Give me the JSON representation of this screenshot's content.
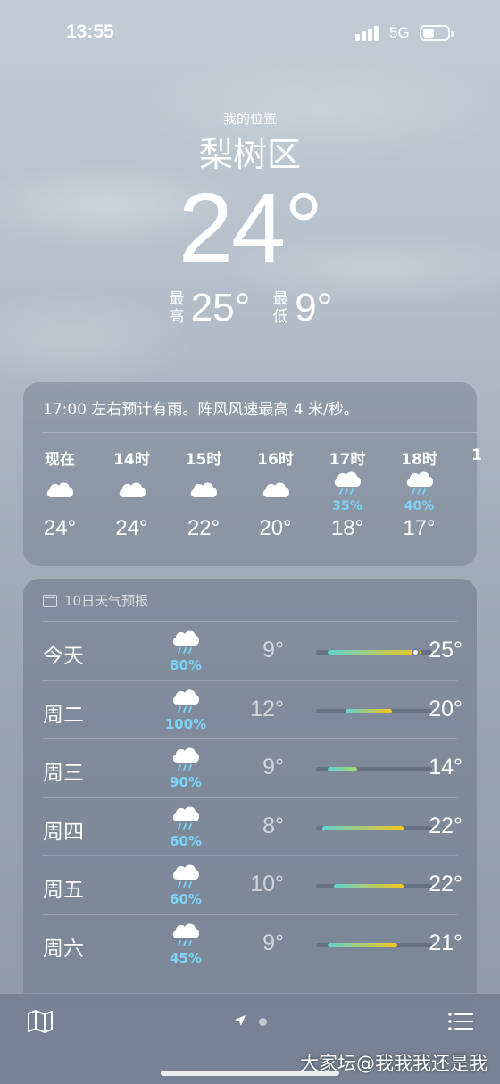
{
  "status_bar": {
    "time": "13:55",
    "network": "5G"
  },
  "header": {
    "my_location": "我的位置",
    "city": "梨树区",
    "temperature": "24°",
    "high_label": "最高",
    "high": "25°",
    "low_label": "最低",
    "low": "9°"
  },
  "hourly": {
    "summary": "17:00 左右预计有雨。阵风风速最高 4 米/秒。",
    "items": [
      {
        "time": "现在",
        "icon": "cloud-icon",
        "precip": "",
        "temp": "24°"
      },
      {
        "time": "14时",
        "icon": "cloud-icon",
        "precip": "",
        "temp": "24°"
      },
      {
        "time": "15时",
        "icon": "cloud-icon",
        "precip": "",
        "temp": "22°"
      },
      {
        "time": "16时",
        "icon": "cloud-icon",
        "precip": "",
        "temp": "20°"
      },
      {
        "time": "17时",
        "icon": "rain-cloud-icon",
        "precip": "35%",
        "temp": "18°"
      },
      {
        "time": "18时",
        "icon": "rain-cloud-icon",
        "precip": "40%",
        "temp": "17°"
      }
    ]
  },
  "daily": {
    "title": "10日天气预报",
    "days": [
      {
        "day": "今天",
        "precip": "80%",
        "low": "9°",
        "high": "25°"
      },
      {
        "day": "周二",
        "precip": "100%",
        "low": "12°",
        "high": "20°"
      },
      {
        "day": "周三",
        "precip": "90%",
        "low": "9°",
        "high": "14°"
      },
      {
        "day": "周四",
        "precip": "60%",
        "low": "8°",
        "high": "22°"
      },
      {
        "day": "周五",
        "precip": "60%",
        "low": "10°",
        "high": "22°"
      },
      {
        "day": "周六",
        "precip": "45%",
        "low": "9°",
        "high": "21°"
      }
    ]
  },
  "bottom_bar": {
    "watermark": "大家坛@我我我还是我"
  },
  "colors": {
    "precip": "#7dd3f5",
    "bar_cool": "#5fd3d0",
    "bar_mild": "#a6d86a",
    "bar_warm": "#f5c518"
  }
}
